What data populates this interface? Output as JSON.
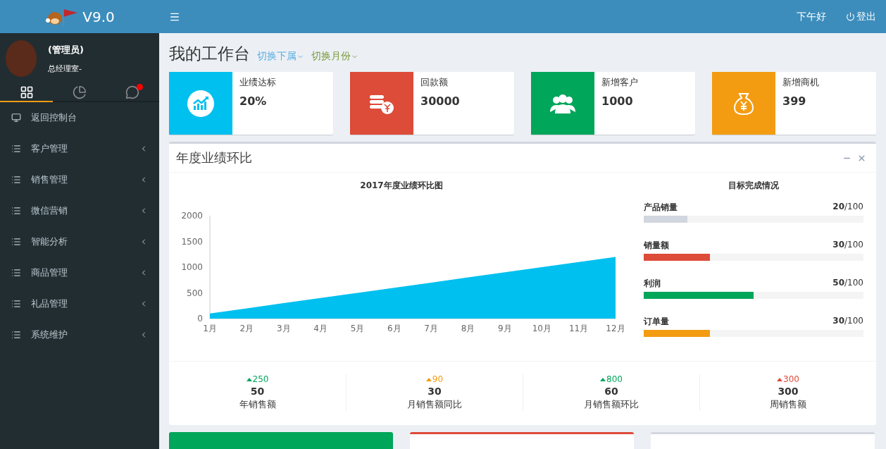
{
  "header": {
    "version": "V9.0",
    "greeting": "下午好",
    "logout": "登出"
  },
  "user": {
    "name": "(管理员)",
    "department": "总经理室-"
  },
  "sidebar_tabs": [
    {
      "kind": "grid",
      "selected": true,
      "badge": false
    },
    {
      "kind": "pie",
      "selected": false,
      "badge": false
    },
    {
      "kind": "chat",
      "selected": false,
      "badge": true
    }
  ],
  "nav": [
    {
      "kind": "link",
      "label": "返回控制台"
    },
    {
      "kind": "menu",
      "label": "客户管理",
      "expanded": false
    },
    {
      "kind": "menu",
      "label": "销售管理",
      "expanded": false
    },
    {
      "kind": "menu",
      "label": "微信营销",
      "expanded": false
    },
    {
      "kind": "menu",
      "label": "智能分析",
      "expanded": false
    },
    {
      "kind": "menu",
      "label": "商品管理",
      "expanded": false
    },
    {
      "kind": "menu",
      "label": "礼品管理",
      "expanded": false
    },
    {
      "kind": "menu",
      "label": "系统维护",
      "expanded": false
    }
  ],
  "page": {
    "title": "我的工作台",
    "switches": [
      {
        "label": "切换下属",
        "color": "#5bafe0"
      },
      {
        "label": "切换月份",
        "color": "#7a9a3a"
      }
    ]
  },
  "stat_cards": [
    {
      "kind": "chart",
      "label": "业绩达标",
      "value": "20%",
      "color": "#00c0ef"
    },
    {
      "kind": "coins",
      "label": "回款额",
      "value": "30000",
      "color": "#dd4b39"
    },
    {
      "kind": "people",
      "label": "新增客户",
      "value": "1000",
      "color": "#00a65a"
    },
    {
      "kind": "moneybag",
      "label": "新增商机",
      "value": "399",
      "color": "#f39c12"
    }
  ],
  "panel": {
    "title": "年度业绩环比",
    "chart_data": {
      "type": "area",
      "title": "2017年度业绩环比图",
      "categories": [
        "1月",
        "2月",
        "3月",
        "4月",
        "5月",
        "6月",
        "7月",
        "8月",
        "9月",
        "10月",
        "11月",
        "12月"
      ],
      "series": [
        {
          "color": "#00c0ef",
          "values": [
            100,
            200,
            300,
            400,
            500,
            600,
            700,
            800,
            900,
            1000,
            1100,
            1200
          ]
        }
      ],
      "ylim": [
        0,
        2000
      ],
      "yticks": [
        0,
        500,
        1000,
        1500,
        2000
      ]
    },
    "goals_title": "目标完成情况",
    "goals": [
      {
        "label": "产品销量",
        "done": "20",
        "total": "/100",
        "level": 0.2,
        "color": "#d2d6de"
      },
      {
        "label": "销量额",
        "done": "30",
        "total": "/100",
        "level": 0.3,
        "color": "#dd4b39"
      },
      {
        "label": "利润",
        "done": "50",
        "total": "/100",
        "level": 0.5,
        "color": "#00a65a"
      },
      {
        "label": "订单量",
        "done": "30",
        "total": "/100",
        "level": 0.3,
        "color": "#f39c12"
      }
    ],
    "summary": [
      {
        "change": "250",
        "value": "50",
        "label": "年销售额",
        "color": "#00a65a"
      },
      {
        "change": "90",
        "value": "30",
        "label": "月销售额同比",
        "color": "#f39c12"
      },
      {
        "change": "800",
        "value": "60",
        "label": "月销售额环比",
        "color": "#00a65a"
      },
      {
        "change": "300",
        "value": "300",
        "label": "周销售额",
        "color": "#dd4b39"
      }
    ]
  },
  "bottom_cards": [
    {
      "kind": "solid",
      "color": "#00a65a"
    },
    {
      "kind": "outlined",
      "color": "#dd4b39"
    },
    {
      "kind": "outlined",
      "color": "#d2d6de"
    }
  ]
}
